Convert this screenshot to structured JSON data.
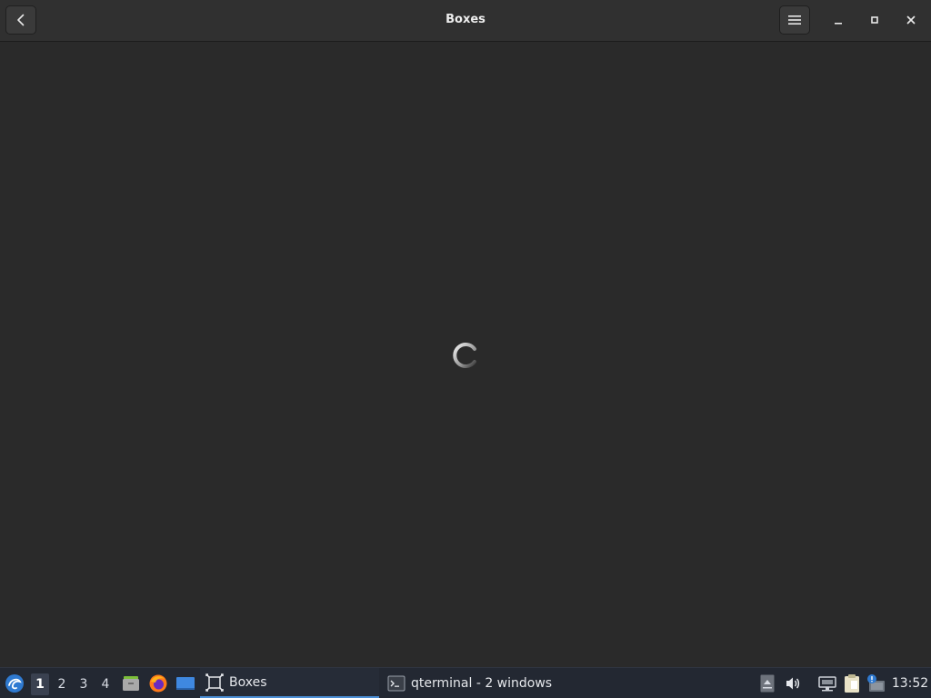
{
  "window": {
    "title": "Boxes",
    "buttons": {
      "back_icon": "chevron-left-icon",
      "menu_icon": "hamburger-menu-icon",
      "minimize_icon": "minimize-icon",
      "maximize_icon": "maximize-icon",
      "close_icon": "close-icon"
    },
    "content": {
      "state": "loading",
      "indicator_icon": "spinner-icon"
    }
  },
  "taskbar": {
    "start_icon": "lxqt-start-menu-icon",
    "desktops": [
      {
        "label": "1",
        "active": true
      },
      {
        "label": "2",
        "active": false
      },
      {
        "label": "3",
        "active": false
      },
      {
        "label": "4",
        "active": false
      }
    ],
    "quicklaunch": [
      {
        "icon": "file-manager-icon"
      },
      {
        "icon": "firefox-icon"
      },
      {
        "icon": "show-desktop-icon"
      }
    ],
    "tasks": [
      {
        "label": "Boxes",
        "icon": "boxes-app-icon",
        "active": true
      },
      {
        "label": "qterminal - 2 windows",
        "icon": "terminal-icon",
        "active": false
      }
    ],
    "tray": [
      {
        "icon": "tray-expand-icon"
      },
      {
        "icon": "volume-icon"
      },
      {
        "icon": "network-icon"
      },
      {
        "icon": "clipboard-icon"
      },
      {
        "icon": "update-notifier-icon"
      }
    ],
    "clock": "13:52"
  },
  "colors": {
    "window_bg": "#2a2a2a",
    "headerbar_bg": "#303030",
    "taskbar_bg": "#232832",
    "accent": "#4b8fd6"
  }
}
